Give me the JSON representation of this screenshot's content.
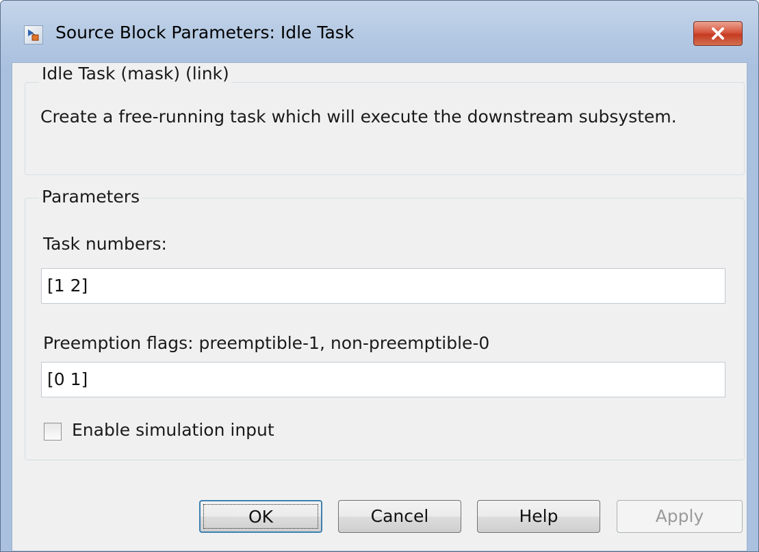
{
  "window": {
    "title": "Source Block Parameters: Idle Task",
    "icon": "simulink-block-icon",
    "close_icon": "close-icon"
  },
  "mask_group": {
    "legend": "Idle Task (mask) (link)",
    "description": "Create a free-running task which will execute the downstream subsystem."
  },
  "parameters_group": {
    "legend": "Parameters",
    "task_numbers": {
      "label": "Task numbers:",
      "value": "[1 2]"
    },
    "preemption_flags": {
      "label": "Preemption flags: preemptible-1, non-preemptible-0",
      "value": "[0 1]"
    },
    "enable_sim_input": {
      "label": "Enable simulation input",
      "checked": false
    }
  },
  "buttons": {
    "ok": "OK",
    "cancel": "Cancel",
    "help": "Help",
    "apply": "Apply"
  },
  "colors": {
    "titlebar": "#b2c7e2",
    "close_button": "#c53b22",
    "client_bg": "#f0f0f0",
    "default_button_border": "#3c7fb1"
  }
}
